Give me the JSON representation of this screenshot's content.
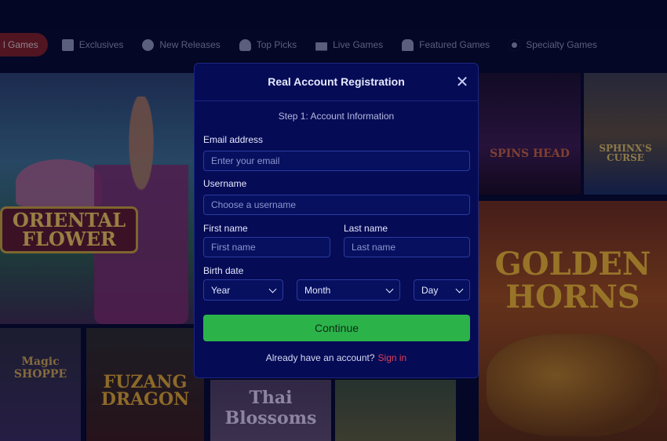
{
  "nav": {
    "categories": [
      {
        "label": "l Games",
        "icon": "none"
      },
      {
        "label": "Exclusives",
        "icon": "exclusive-icon"
      },
      {
        "label": "New Releases",
        "icon": "new-releases-icon"
      },
      {
        "label": "Top Picks",
        "icon": "top-picks-icon"
      },
      {
        "label": "Live Games",
        "icon": "live-games-icon"
      },
      {
        "label": "Featured Games",
        "icon": "featured-games-icon"
      },
      {
        "label": "Specialty Games",
        "icon": "specialty-games-icon"
      }
    ],
    "active_color": "#7a1e24"
  },
  "games": {
    "oriental": "ORIENTAL FLOWER",
    "spins": "SPINS HEAD",
    "sphinx": "SPHINX'S CURSE",
    "golden": "GOLDEN HORNS",
    "magic": "Magic SHOPPE",
    "fuzang": "FUZANG DRAGON",
    "thai": "Thai Blossoms"
  },
  "modal": {
    "title": "Real Account Registration",
    "step": "Step 1: Account Information",
    "email_label": "Email address",
    "email_placeholder": "Enter your email",
    "username_label": "Username",
    "username_placeholder": "Choose a username",
    "firstname_label": "First name",
    "firstname_placeholder": "First name",
    "lastname_label": "Last name",
    "lastname_placeholder": "Last name",
    "birthdate_label": "Birth date",
    "year": "Year",
    "month": "Month",
    "day": "Day",
    "continue_label": "Continue",
    "have_account": "Already have an account?",
    "signin_label": "Sign in",
    "accent": "#2bb34a",
    "link_color": "#e0405a"
  }
}
